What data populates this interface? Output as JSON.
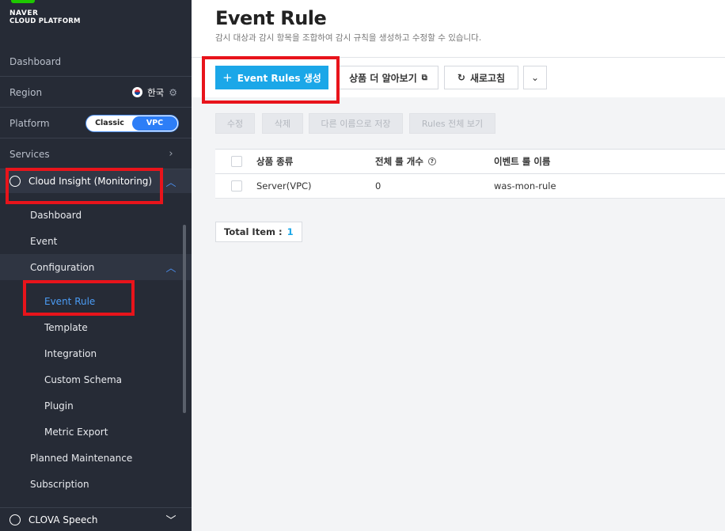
{
  "logo": {
    "brand": "NAVER",
    "product": "CLOUD PLATFORM"
  },
  "sidebar": {
    "dashboard": "Dashboard",
    "region": {
      "label": "Region",
      "value": "한국"
    },
    "platform": {
      "label": "Platform",
      "options": [
        "Classic",
        "VPC"
      ],
      "selected": "VPC"
    },
    "services": "Services",
    "cloud_insight": "Cloud Insight (Monitoring)",
    "items": {
      "dashboard": "Dashboard",
      "event": "Event",
      "configuration": "Configuration",
      "event_rule": "Event Rule",
      "template": "Template",
      "integration": "Integration",
      "custom_schema": "Custom Schema",
      "plugin": "Plugin",
      "metric_export": "Metric Export",
      "planned_maintenance": "Planned Maintenance",
      "subscription": "Subscription"
    },
    "clova": "CLOVA Speech"
  },
  "header": {
    "title": "Event Rule",
    "description": "감시 대상과 감시 항목을 조합하여 감시 규칙을 생성하고 수정할 수 있습니다."
  },
  "toolbar": {
    "create": "Event Rules 생성",
    "learn_more": "상품 더 알아보기",
    "refresh": "새로고침"
  },
  "actions": {
    "edit": "수정",
    "delete": "삭제",
    "save_as": "다른 이름으로 저장",
    "view_all": "Rules 전체 보기"
  },
  "table": {
    "columns": [
      "상품 종류",
      "전체 룰 개수",
      "이벤트 룰 이름"
    ],
    "rows": [
      {
        "product": "Server(VPC)",
        "count": "0",
        "name": "was-mon-rule"
      }
    ]
  },
  "total": {
    "label": "Total Item :",
    "value": "1"
  },
  "colors": {
    "primary": "#1ba7e8",
    "sidebar_bg": "#262b36",
    "highlight": "#e8141b",
    "brand_green": "#1ec800"
  }
}
